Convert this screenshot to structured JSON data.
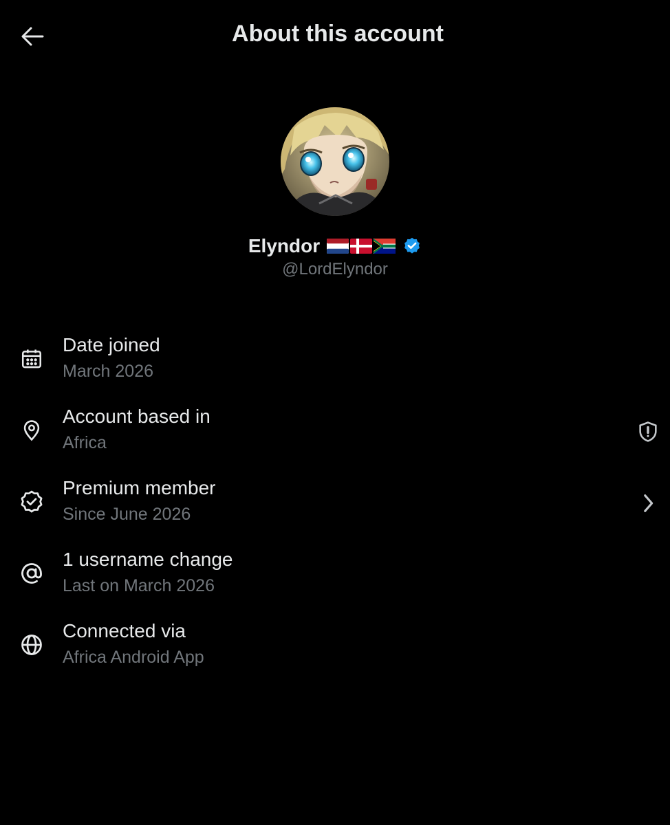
{
  "header": {
    "title": "About this account",
    "back_icon": "arrow-left-icon"
  },
  "profile": {
    "display_name": "Elyndor",
    "flags": [
      "Netherlands flag",
      "Denmark flag",
      "South Africa flag"
    ],
    "verified_icon": "verified-badge-icon",
    "handle": "@LordElyndor",
    "avatar": "anime character avatar"
  },
  "info": {
    "items": [
      {
        "title": "Date joined",
        "subtitle": "March 2026",
        "icon": "calendar-icon"
      },
      {
        "title": "Account based in",
        "subtitle": "Africa",
        "icon": "location-pin-icon",
        "right_icon": "shield-alert-icon"
      },
      {
        "title": "Premium member",
        "subtitle": "Since June 2026",
        "icon": "verified-check-icon",
        "right_icon": "chevron-right-icon"
      },
      {
        "title": "1 username change",
        "subtitle": "Last on March 2026",
        "icon": "at-sign-icon"
      },
      {
        "title": "Connected via",
        "subtitle": "Africa Android App",
        "icon": "globe-icon"
      }
    ]
  },
  "colors": {
    "background": "#000000",
    "primary_text": "#e7e9ea",
    "secondary_text": "#71767b",
    "verified_blue": "#1d9bf0"
  }
}
